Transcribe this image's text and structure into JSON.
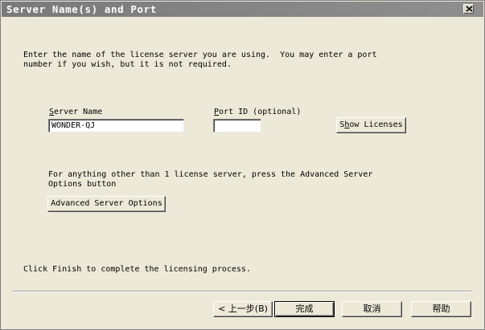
{
  "window": {
    "title": "Server Name(s) and Port",
    "close_label": "×"
  },
  "intro": {
    "line1": "Enter the name of the license server you are using.  You may enter a port",
    "line2": "number if you wish, but it is not required."
  },
  "server_name": {
    "label_prefix": "",
    "label_mnemonic": "S",
    "label_rest": "erver Name",
    "value": "WONDER-QJ"
  },
  "port_id": {
    "label_mnemonic": "P",
    "label_rest": "ort ID (optional)",
    "value": ""
  },
  "show_licenses": {
    "label_prefix": "S",
    "label_mnemonic": "h",
    "label_rest": "ow Licenses"
  },
  "advanced": {
    "line1": "For anything other than 1 license server, press the Advanced Server",
    "line2": "Options button",
    "button_label": "Advanced Server Options"
  },
  "finish_text": "Click Finish to complete the licensing process.",
  "nav": {
    "back": "< 上一步(B)",
    "finish": "完成",
    "cancel": "取消",
    "help": "帮助"
  }
}
